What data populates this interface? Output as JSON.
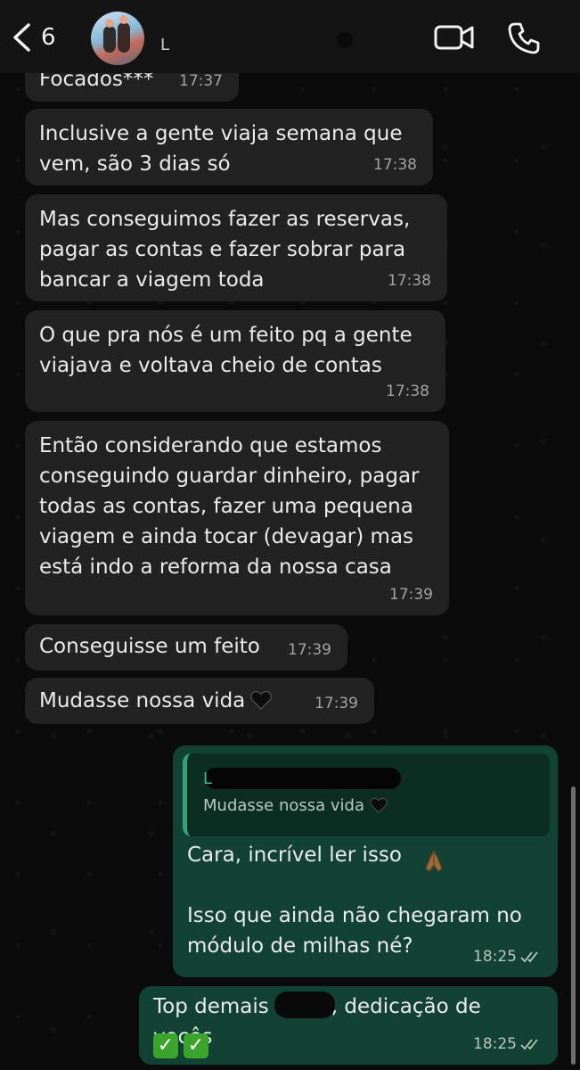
{
  "header": {
    "back_count": "6",
    "contact_name": "L",
    "icons": {
      "back": "chevron-left-icon",
      "video": "video-call-icon",
      "call": "phone-icon"
    }
  },
  "messages": [
    {
      "text": "Focados***",
      "time": "17:37"
    },
    {
      "text": "Inclusive a gente viaja semana que\nvem, são 3 dias só",
      "time": "17:38"
    },
    {
      "text": "Mas conseguimos fazer as reservas,\npagar as contas e fazer sobrar para\nbancar a viagem toda",
      "time": "17:38"
    },
    {
      "text": "O que pra nós é um feito pq a gente\nviajava e voltava cheio de contas",
      "time": "17:38"
    },
    {
      "text": "Então considerando que estamos\nconseguindo guardar dinheiro, pagar\ntodas as contas, fazer uma pequena\nviagem e ainda tocar (devagar) mas\nestá indo a reforma da nossa casa",
      "time": "17:39"
    },
    {
      "text": "Conseguisse um feito",
      "time": "17:39"
    },
    {
      "text": "Mudasse nossa vida",
      "time": "17:39"
    }
  ],
  "reply": {
    "quoted_name": "L",
    "quoted_text": "Mudasse nossa vida",
    "text": "Cara, incrível ler isso\n\nIsso que ainda não chegaram no\nmódulo de milhas né?",
    "time": "18:25"
  },
  "last": {
    "text_before": "Top demais",
    "text_after": ", dedicação de vocês",
    "check1": "✓",
    "check2": "✓",
    "time": "18:25"
  },
  "colors": {
    "incoming": "#222222",
    "outgoing": "#124233",
    "quote_bar": "#2fa577"
  }
}
